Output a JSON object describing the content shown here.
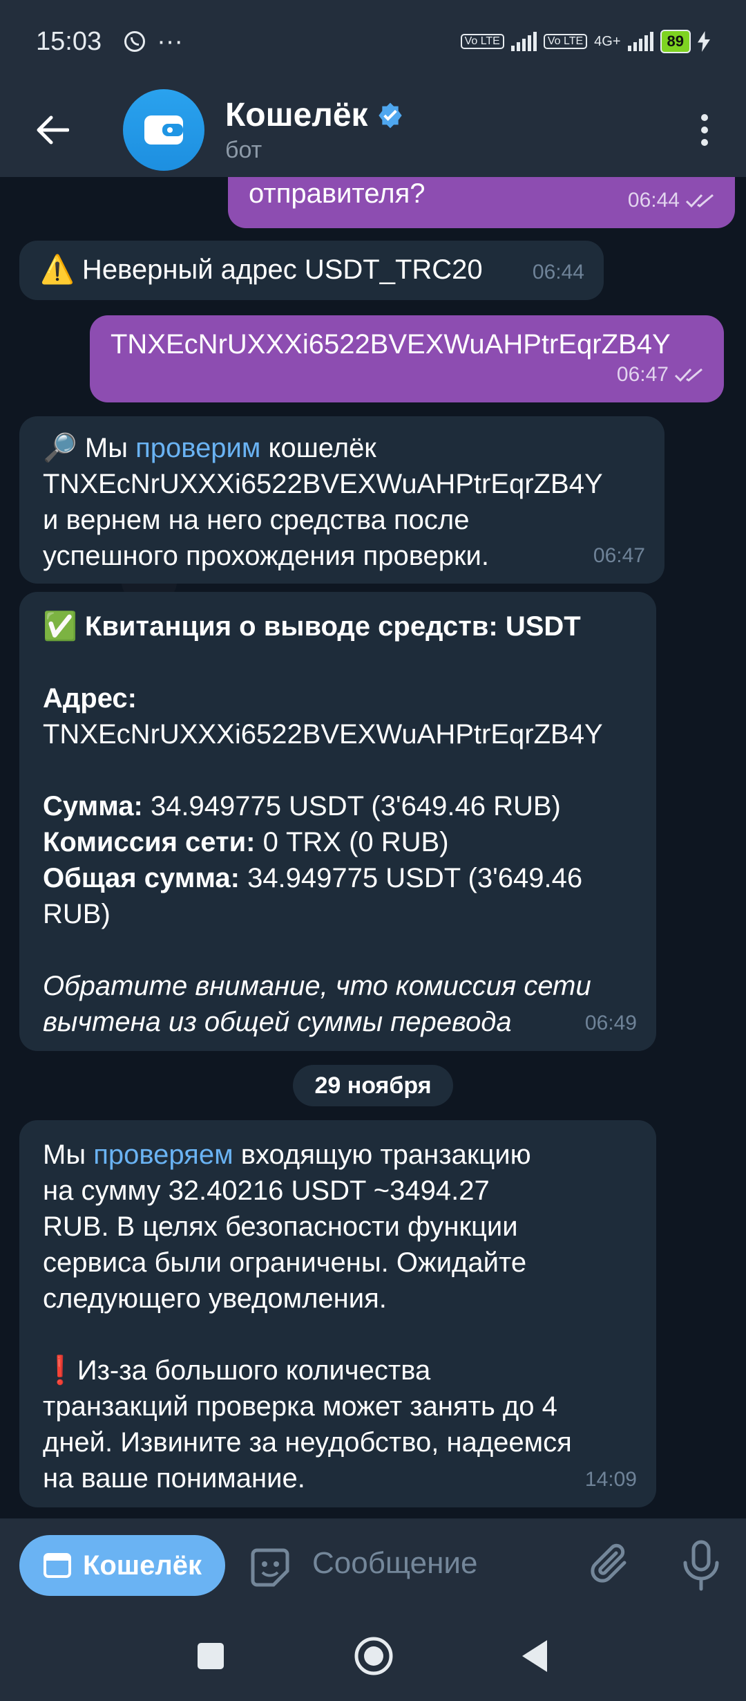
{
  "status": {
    "time": "15:03",
    "lte1": "Vo LTE",
    "lte2": "Vo LTE",
    "net": "4G+",
    "battery": "89"
  },
  "header": {
    "title": "Кошелёк",
    "subtitle": "бот"
  },
  "messages": {
    "m1": {
      "text": "отправителя?",
      "time": "06:44"
    },
    "m2": {
      "emoji": "⚠️",
      "text": " Неверный адрес USDT_TRC20",
      "time": "06:44"
    },
    "m3": {
      "text": "TNXEcNrUXXXi6522BVEXWuAHPtrEqrZB4Y",
      "time": "06:47"
    },
    "m4": {
      "emoji": "🔎",
      "pre": " Мы ",
      "link": "проверим",
      "post": " кошелёк",
      "line2": "TNXEcNrUXXXi6522BVEXWuAHPtrEqrZB4Y",
      "line3": "и вернем на него средства после",
      "line4": "успешного прохождения проверки.",
      "time": "06:47"
    },
    "m5": {
      "emoji": "✅",
      "title": " Квитанция о выводе средств: USDT",
      "address_label": "Адрес:",
      "address": "TNXEcNrUXXXi6522BVEXWuAHPtrEqrZB4Y",
      "sum_label": "Сумма:",
      "sum": " 34.949775 USDT (3'649.46 RUB)",
      "fee_label": "Комиссия сети:",
      "fee": " 0 TRX (0 RUB)",
      "total_label": "Общая сумма:",
      "total_line1": " 34.949775 USDT (3'649.46",
      "total_line2": "RUB)",
      "note_line1": "Обратите внимание, что комиссия сети",
      "note_line2": "вычтена из общей суммы перевода",
      "time": "06:49"
    },
    "date_chip": "29 ноября",
    "m6": {
      "pre": "Мы ",
      "link": "проверяем",
      "post": " входящую транзакцию",
      "line2": "на сумму 32.40216 USDT ~3494.27",
      "line3": "RUB. В целях безопасности функции",
      "line4": "сервиса были ограничены. Ожидайте",
      "line5": "следующего уведомления.",
      "emoji": "❗",
      "warn_line1": "Из-за большого количества",
      "warn_line2": "транзакций проверка может занять до 4",
      "warn_line3": "дней. Извините за неудобство, надеемся",
      "warn_line4": "на ваше понимание.",
      "time": "14:09"
    }
  },
  "input": {
    "wallet_button": "Кошелёк",
    "placeholder": "Сообщение"
  },
  "colors": {
    "accent": "#6ab3f3",
    "outgoing": "#8d4db1",
    "incoming": "#1e2c3a"
  },
  "icons": [
    "back-arrow-icon",
    "wallet-icon",
    "verified-icon",
    "more-vert-icon",
    "sticker-icon",
    "paperclip-icon",
    "mic-icon",
    "double-check-icon"
  ]
}
